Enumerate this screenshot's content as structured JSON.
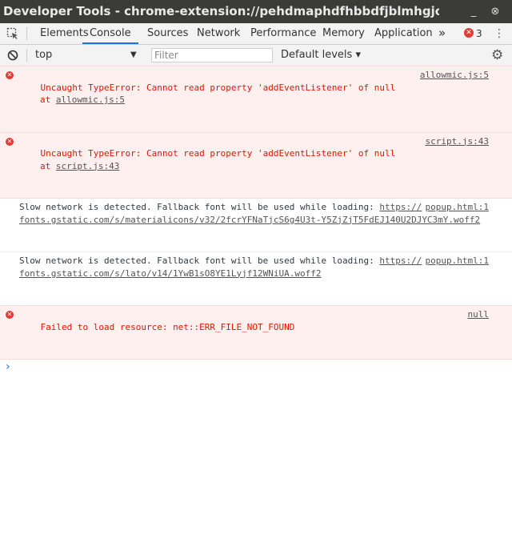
{
  "window": {
    "title": "Developer Tools - chrome-extension://pehdmaphdfhbbdfjblmhgjodmbikjd...",
    "minimize_glyph": "_",
    "close_glyph": "⊗"
  },
  "tabs": {
    "items": [
      "Elements",
      "Console",
      "Sources",
      "Network",
      "Performance",
      "Memory",
      "Application"
    ],
    "active": "Console",
    "more_glyph": "»",
    "error_count": "3",
    "menu_glyph": "⋮"
  },
  "console_toolbar": {
    "context": "top",
    "filter_placeholder": "Filter",
    "levels": "Default levels ▾"
  },
  "messages": [
    {
      "level": "error",
      "text": "Uncaught TypeError: Cannot read property 'addEventListener' of null",
      "at_prefix": "at ",
      "at_link": "allowmic.js:5",
      "source": "allowmic.js:5"
    },
    {
      "level": "error",
      "text": "Uncaught TypeError: Cannot read property 'addEventListener' of null",
      "at_prefix": "at ",
      "at_link": "script.js:43",
      "source": "script.js:43"
    },
    {
      "level": "info",
      "text": "Slow network is detected. Fallback font will be used while loading: ",
      "link_start": "https://",
      "link_rest": "fonts.gstatic.com/s/materialicons/v32/2fcrYFNaTjcS6g4U3t-Y5ZjZjT5FdEJ140U2DJYC3mY.woff2",
      "source": "popup.html:1"
    },
    {
      "level": "info",
      "text": "Slow network is detected. Fallback font will be used while loading: ",
      "link_start": "https://",
      "link_rest": "fonts.gstatic.com/s/lato/v14/1YwB1sO8YE1Lyjf12WNiUA.woff2",
      "source": "popup.html:1"
    },
    {
      "level": "error",
      "text": "Failed to load resource: net::ERR_FILE_NOT_FOUND",
      "source": "null"
    }
  ],
  "prompt_glyph": "›",
  "colors": {
    "titlebar": "#3b3b3a",
    "toolbar": "#f3f3f3",
    "active_tab": "#1a73e8",
    "error_text": "#e51400",
    "error_bg": "#fff0f0",
    "error_icon": "#e53935"
  }
}
